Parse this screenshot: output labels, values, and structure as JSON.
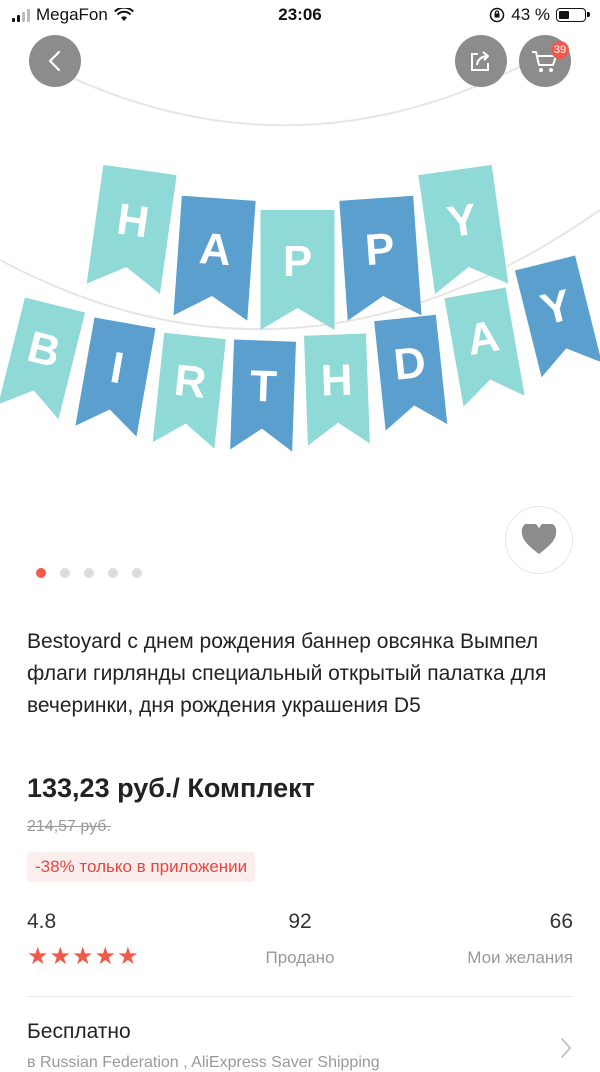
{
  "status_bar": {
    "carrier": "MegaFon",
    "time": "23:06",
    "battery": "43 %",
    "battery_level": 0.43
  },
  "nav": {
    "cart_count": "39"
  },
  "gallery": {
    "image_count": 5,
    "active_index": 0,
    "garland_row1": [
      "H",
      "A",
      "P",
      "P",
      "Y"
    ],
    "garland_row2": [
      "B",
      "I",
      "R",
      "T",
      "H",
      "D",
      "A",
      "Y"
    ]
  },
  "product": {
    "title": "Bestoyard с днем рождения баннер овсянка Вымпел флаги гирлянды специальный открытый палатка для вечеринки, дня рождения украшения D5",
    "price": "133,23 руб./ Комплект",
    "old_price": "214,57 руб.",
    "discount": "-38% только в приложении"
  },
  "stats": {
    "rating": "4.8",
    "stars": 5,
    "sold_value": "92",
    "sold_label": "Продано",
    "wishes_value": "66",
    "wishes_label": "Мои желания"
  },
  "shipping": {
    "title": "Бесплатно",
    "subtitle": "в Russian Federation , AliExpress Saver Shipping"
  },
  "colors": {
    "accent": "#f05a4a",
    "flag_light": "#8fd9d6",
    "flag_dark": "#5b9fcf"
  }
}
